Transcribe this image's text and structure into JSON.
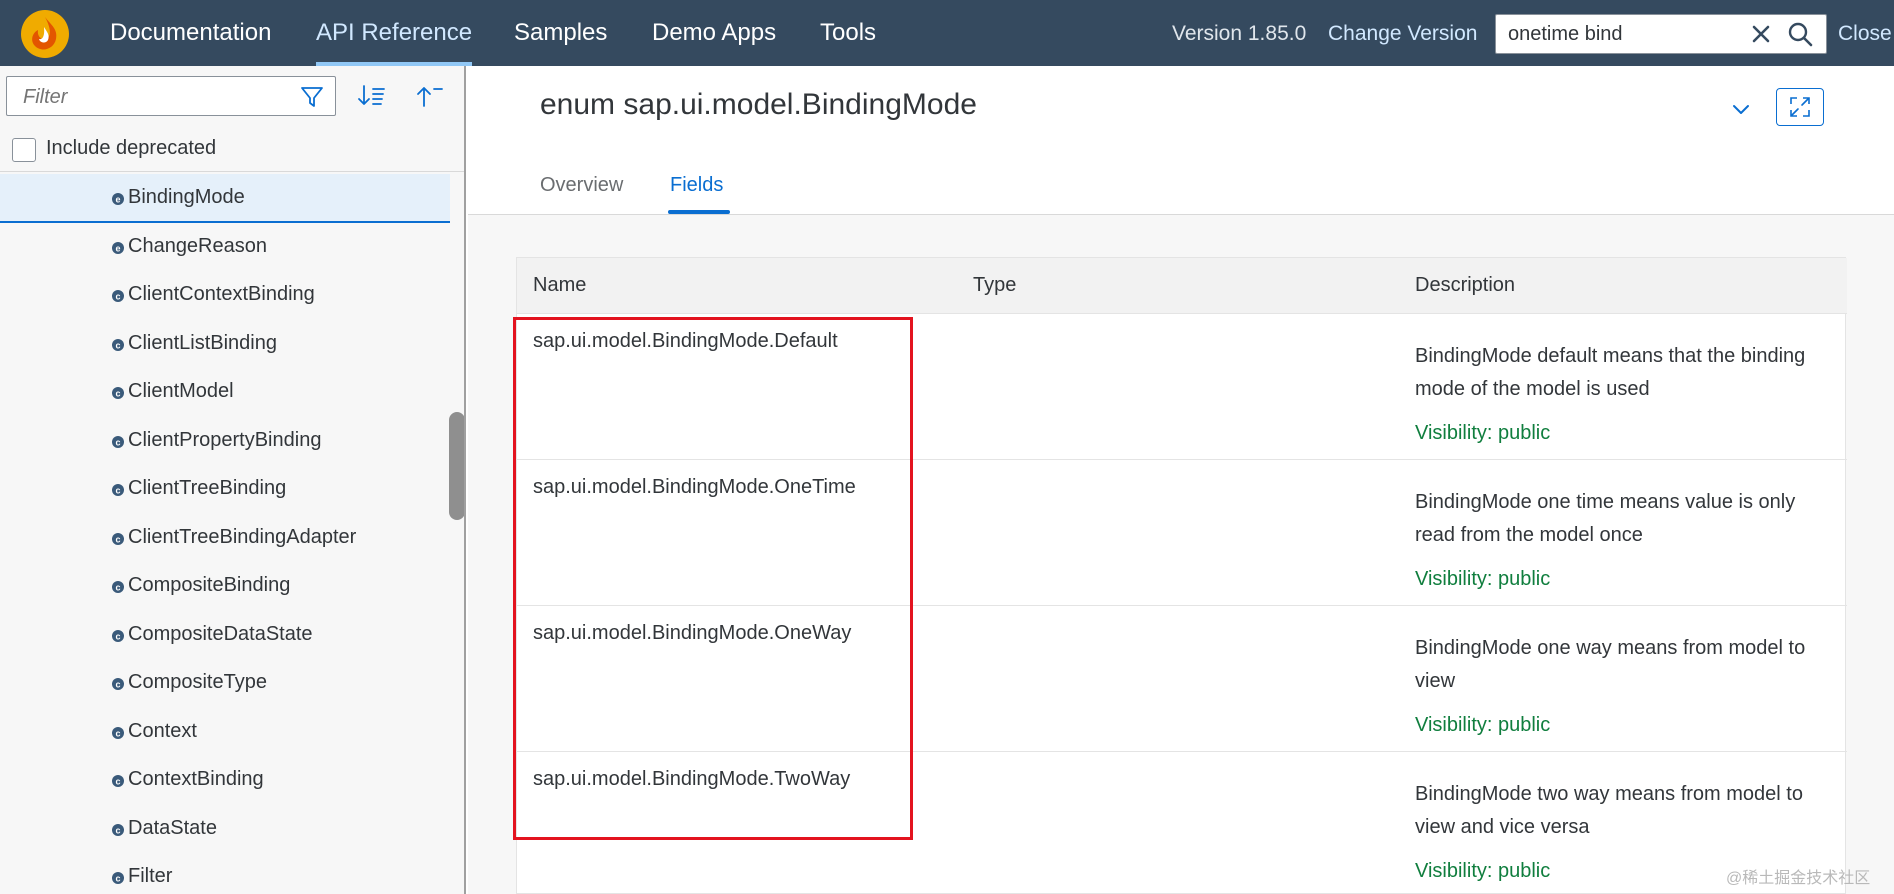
{
  "header": {
    "nav": [
      {
        "label": "Documentation",
        "active": false
      },
      {
        "label": "API Reference",
        "active": true
      },
      {
        "label": "Samples",
        "active": false
      },
      {
        "label": "Demo Apps",
        "active": false
      },
      {
        "label": "Tools",
        "active": false
      }
    ],
    "version": "Version 1.85.0",
    "change_version": "Change Version",
    "search": {
      "value": "onetime bind"
    },
    "close": "Close"
  },
  "sidebar": {
    "filter_placeholder": "Filter",
    "include_deprecated": "Include deprecated",
    "include_deprecated_checked": false,
    "items": [
      {
        "label": "BindingMode",
        "icon": "enum-icon",
        "selected": true
      },
      {
        "label": "ChangeReason",
        "icon": "enum-icon",
        "selected": false
      },
      {
        "label": "ClientContextBinding",
        "icon": "class-icon",
        "selected": false
      },
      {
        "label": "ClientListBinding",
        "icon": "class-icon",
        "selected": false
      },
      {
        "label": "ClientModel",
        "icon": "class-icon",
        "selected": false
      },
      {
        "label": "ClientPropertyBinding",
        "icon": "class-icon",
        "selected": false
      },
      {
        "label": "ClientTreeBinding",
        "icon": "class-icon",
        "selected": false
      },
      {
        "label": "ClientTreeBindingAdapter",
        "icon": "class-icon",
        "selected": false
      },
      {
        "label": "CompositeBinding",
        "icon": "class-icon",
        "selected": false
      },
      {
        "label": "CompositeDataState",
        "icon": "class-icon",
        "selected": false
      },
      {
        "label": "CompositeType",
        "icon": "class-icon",
        "selected": false
      },
      {
        "label": "Context",
        "icon": "class-icon",
        "selected": false
      },
      {
        "label": "ContextBinding",
        "icon": "class-icon",
        "selected": false
      },
      {
        "label": "DataState",
        "icon": "class-icon",
        "selected": false
      },
      {
        "label": "Filter",
        "icon": "class-icon",
        "selected": false
      }
    ]
  },
  "main": {
    "title": "enum sap.ui.model.BindingMode",
    "tabs": [
      {
        "label": "Overview",
        "active": false
      },
      {
        "label": "Fields",
        "active": true
      }
    ],
    "table": {
      "columns": [
        "Name",
        "Type",
        "Description"
      ],
      "rows": [
        {
          "name": "sap.ui.model.BindingMode.Default",
          "type": "",
          "description": "BindingMode default means that the binding mode of the model is used",
          "visibility": "Visibility: public"
        },
        {
          "name": "sap.ui.model.BindingMode.OneTime",
          "type": "",
          "description": "BindingMode one time means value is only read from the model once",
          "visibility": "Visibility: public"
        },
        {
          "name": "sap.ui.model.BindingMode.OneWay",
          "type": "",
          "description": "BindingMode one way means from model to view",
          "visibility": "Visibility: public"
        },
        {
          "name": "sap.ui.model.BindingMode.TwoWay",
          "type": "",
          "description": "BindingMode two way means from model to view and vice versa",
          "visibility": "Visibility: public"
        }
      ]
    }
  },
  "watermark": "@稀土掘金技术社区",
  "colors": {
    "header_bg": "#354a5f",
    "accent": "#0a6ed1",
    "visibility_green": "#107e3e",
    "highlight_red": "#e3131f"
  }
}
